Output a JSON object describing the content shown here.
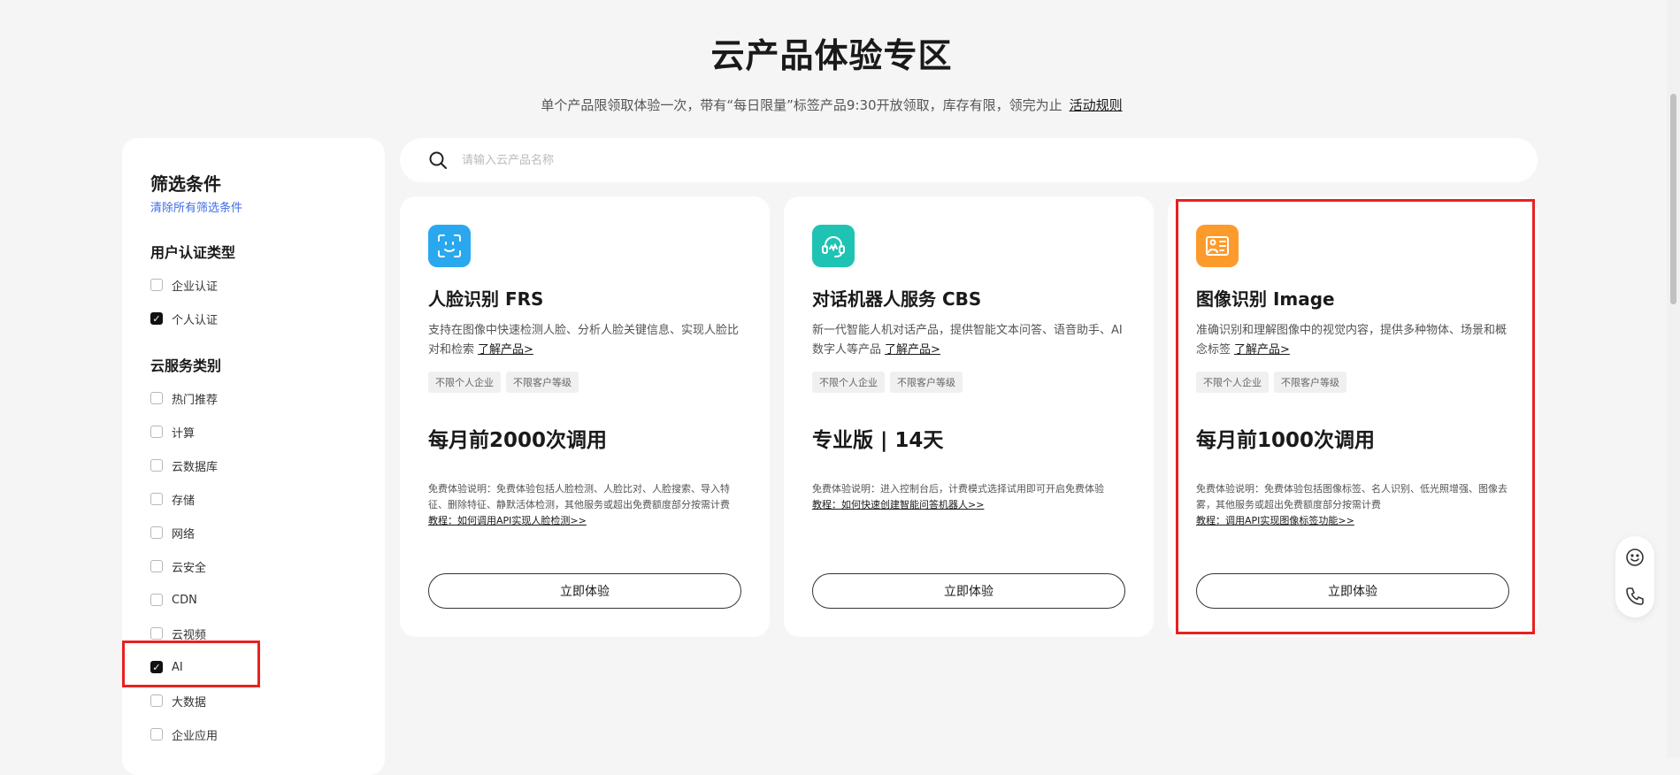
{
  "header": {
    "title": "云产品体验专区",
    "subtitle": "单个产品限领取体验一次，带有“每日限量”标签产品9:30开放领取，库存有限，领完为止",
    "rules_link": "活动规则"
  },
  "sidebar": {
    "title": "筛选条件",
    "clear_label": "清除所有筛选条件",
    "auth_group": {
      "title": "用户认证类型",
      "items": [
        {
          "label": "企业认证",
          "checked": false
        },
        {
          "label": "个人认证",
          "checked": true
        }
      ]
    },
    "category_group": {
      "title": "云服务类别",
      "items": [
        {
          "label": "热门推荐",
          "checked": false
        },
        {
          "label": "计算",
          "checked": false
        },
        {
          "label": "云数据库",
          "checked": false
        },
        {
          "label": "存储",
          "checked": false
        },
        {
          "label": "网络",
          "checked": false
        },
        {
          "label": "云安全",
          "checked": false
        },
        {
          "label": "CDN",
          "checked": false
        },
        {
          "label": "云视频",
          "checked": false
        },
        {
          "label": "AI",
          "checked": true
        },
        {
          "label": "大数据",
          "checked": false
        },
        {
          "label": "企业应用",
          "checked": false
        }
      ]
    }
  },
  "search": {
    "placeholder": "请输入云产品名称"
  },
  "cards": [
    {
      "icon": "face-scan-icon",
      "icon_color": "#29a8ef",
      "name": "人脸识别 FRS",
      "description": "支持在图像中快速检测人脸、分析人脸关键信息、实现人脸比对和检索",
      "learn_more": "了解产品>",
      "tags": [
        "不限个人企业",
        "不限客户等级"
      ],
      "offer": "每月前2000次调用",
      "note": "免费体验说明：免费体验包括人脸检测、人脸比对、人脸搜索、导入特征、删除特征、静默活体检测，其他服务或超出免费额度部分按需计费",
      "tutorial": "教程：如何调用API实现人脸检测>>",
      "button": "立即体验"
    },
    {
      "icon": "chatbot-headset-icon",
      "icon_color": "#1ec3b4",
      "name": "对话机器人服务 CBS",
      "description": "新一代智能人机对话产品，提供智能文本问答、语音助手、AI数字人等产品",
      "learn_more": "了解产品>",
      "tags": [
        "不限个人企业",
        "不限客户等级"
      ],
      "offer": "专业版 | 14天",
      "note": "免费体验说明：进入控制台后，计费模式选择试用即可开启免费体验",
      "tutorial": "教程：如何快速创建智能问答机器人>>",
      "button": "立即体验"
    },
    {
      "icon": "image-recognition-icon",
      "icon_color": "#fd9a2c",
      "name": "图像识别 Image",
      "description": "准确识别和理解图像中的视觉内容，提供多种物体、场景和概念标签",
      "learn_more": "了解产品>",
      "tags": [
        "不限个人企业",
        "不限客户等级"
      ],
      "offer": "每月前1000次调用",
      "note": "免费体验说明：免费体验包括图像标签、名人识别、低光照增强、图像去雾，其他服务或超出免费额度部分按需计费",
      "tutorial": "教程：调用API实现图像标签功能>>",
      "button": "立即体验"
    }
  ],
  "float_panel": {
    "icons": [
      "smiley-icon",
      "phone-icon"
    ]
  },
  "colors": {
    "highlight": "#e8211f",
    "link": "#3d6ee8",
    "page_bg": "#f5f5f5"
  }
}
